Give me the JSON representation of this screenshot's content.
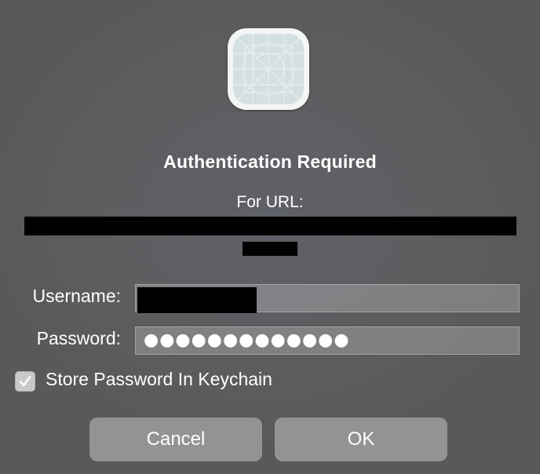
{
  "dialog": {
    "title": "Authentication Required",
    "for_url_label": "For URL:",
    "fields": {
      "username_label": "Username:",
      "password_label": "Password:",
      "password_masked": "●●●●●●●●●●●●●"
    },
    "store_password": {
      "label": "Store Password In Keychain",
      "checked": true
    },
    "buttons": {
      "cancel": "Cancel",
      "ok": "OK"
    },
    "icon": "app-placeholder-icon"
  }
}
